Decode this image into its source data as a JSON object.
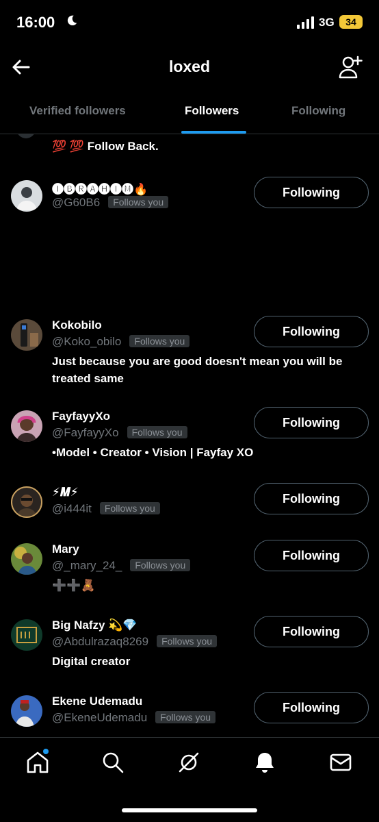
{
  "status": {
    "time": "16:00",
    "network": "3G",
    "battery": "34"
  },
  "header": {
    "title": "loxed"
  },
  "tabs": [
    {
      "label": "Verified followers"
    },
    {
      "label": "Followers"
    },
    {
      "label": "Following"
    }
  ],
  "partial_bio": "💯 💯 Follow Back.",
  "rows": [
    {
      "name": "🅘🅑🅡🅐🅗🅘🅜🔥",
      "handle": "@G60B6",
      "follows_you": "Follows you",
      "button": "Following",
      "bio": ""
    },
    {
      "name": "Kokobilo",
      "handle": "@Koko_obilo",
      "follows_you": "Follows you",
      "button": "Following",
      "bio": "Just because you are good doesn't mean you will be treated same"
    },
    {
      "name": "FayfayyXo",
      "handle": "@FayfayyXo",
      "follows_you": "Follows you",
      "button": "Following",
      "bio": "•Model • Creator • Vision | Fayfay XO"
    },
    {
      "name": "⚡𝑴⚡",
      "handle": "@i444it",
      "follows_you": "Follows you",
      "button": "Following",
      "bio": ""
    },
    {
      "name": "Mary",
      "handle": "@_mary_24_",
      "follows_you": "Follows you",
      "button": "Following",
      "bio": "➕➕🧸"
    },
    {
      "name": "Big Nafzy 💫💎",
      "handle": "@Abdulrazaq8269",
      "follows_you": "Follows you",
      "button": "Following",
      "bio": "Digital creator"
    },
    {
      "name": "Ekene Udemadu",
      "handle": "@EkeneUdemadu",
      "follows_you": "Follows you",
      "button": "Following",
      "bio": ""
    }
  ],
  "icons": [
    "back-arrow-icon",
    "add-user-icon",
    "home-icon",
    "search-icon",
    "grok-icon",
    "bell-icon",
    "mail-icon"
  ],
  "colors": {
    "accent": "#1d9bf0",
    "background": "#000000",
    "muted": "#71767b",
    "battery": "#f3c838"
  }
}
